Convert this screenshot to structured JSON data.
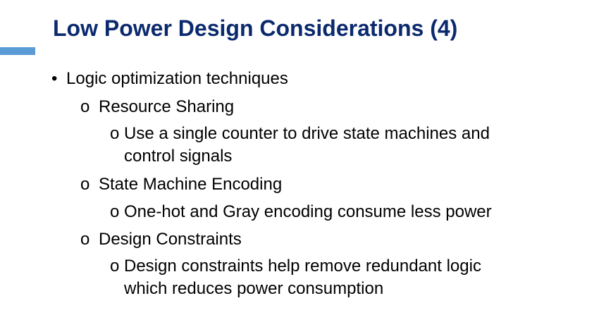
{
  "slide": {
    "title": "Low Power Design Considerations (4)",
    "accent_color": "#5b9bd5",
    "title_color": "#0b2a6e",
    "bullets": {
      "level1_marker": "•",
      "level2_marker": "o",
      "level3_marker": "o",
      "main": "Logic optimization techniques",
      "sub1": {
        "label": "Resource Sharing",
        "detail_line1": "Use a single counter to drive state machines and",
        "detail_line2": "control signals"
      },
      "sub2": {
        "label": "State Machine Encoding",
        "detail_line1": "One-hot and Gray encoding consume less power"
      },
      "sub3": {
        "label": "Design Constraints",
        "detail_line1": "Design constraints help remove redundant logic",
        "detail_line2": "which reduces power consumption"
      }
    }
  }
}
